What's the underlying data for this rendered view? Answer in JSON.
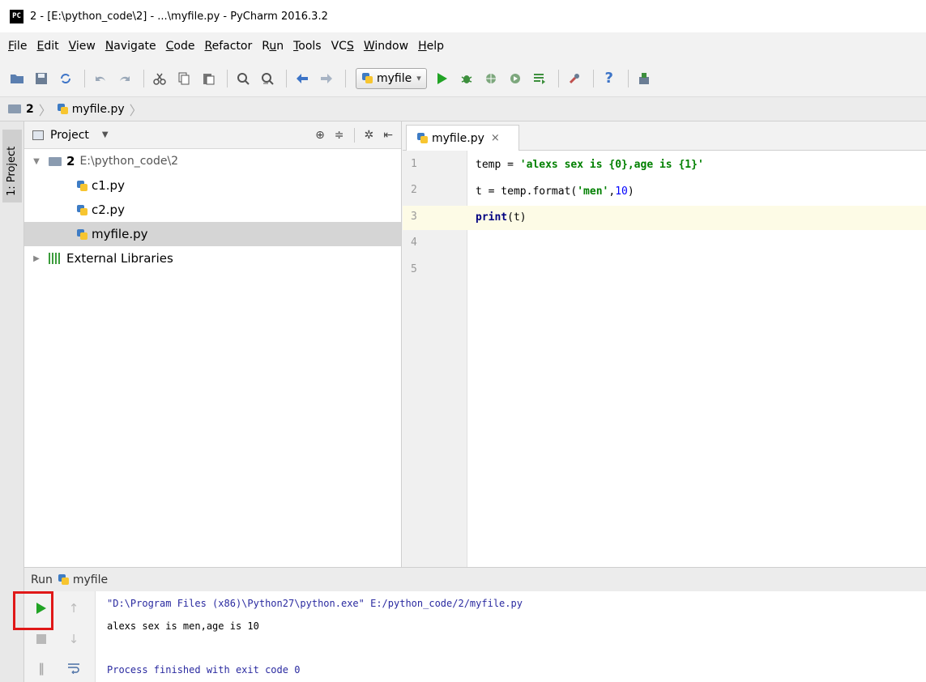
{
  "window": {
    "title": "2 - [E:\\python_code\\2] - ...\\myfile.py - PyCharm 2016.3.2",
    "logo_text": "PC"
  },
  "menu": {
    "items": [
      {
        "pre": "",
        "mnemonic": "F",
        "post": "ile"
      },
      {
        "pre": "",
        "mnemonic": "E",
        "post": "dit"
      },
      {
        "pre": "",
        "mnemonic": "V",
        "post": "iew"
      },
      {
        "pre": "",
        "mnemonic": "N",
        "post": "avigate"
      },
      {
        "pre": "",
        "mnemonic": "C",
        "post": "ode"
      },
      {
        "pre": "",
        "mnemonic": "R",
        "post": "efactor"
      },
      {
        "pre": "R",
        "mnemonic": "u",
        "post": "n"
      },
      {
        "pre": "",
        "mnemonic": "T",
        "post": "ools"
      },
      {
        "pre": "VC",
        "mnemonic": "S",
        "post": ""
      },
      {
        "pre": "",
        "mnemonic": "W",
        "post": "indow"
      },
      {
        "pre": "",
        "mnemonic": "H",
        "post": "elp"
      }
    ]
  },
  "toolbar": {
    "run_config": "myfile",
    "run_config_caret": "▾"
  },
  "breadcrumb": {
    "project": "2",
    "file": "myfile.py"
  },
  "side_tab": {
    "label": "1: Project"
  },
  "project_panel": {
    "title": "Project",
    "caret": "▼",
    "root": {
      "name": "2",
      "path": "E:\\python_code\\2"
    },
    "files": [
      {
        "name": "c1.py",
        "selected": false
      },
      {
        "name": "c2.py",
        "selected": false
      },
      {
        "name": "myfile.py",
        "selected": true
      }
    ],
    "external": "External Libraries"
  },
  "editor": {
    "tab": {
      "label": "myfile.py",
      "close": "×"
    },
    "line_numbers": [
      "1",
      "2",
      "3",
      "4",
      "5"
    ],
    "code": {
      "l1_a": "temp = ",
      "l1_str": "'alexs sex is {0},age is {1}'",
      "l2_a": "t = temp.format(",
      "l2_str": "'men'",
      "l2_b": ",",
      "l2_num": "10",
      "l2_c": ")",
      "l3_kw": "print",
      "l3_a": "(t)"
    }
  },
  "run": {
    "header_label": "Run",
    "config": "myfile",
    "console": {
      "cmd": "\"D:\\Program Files (x86)\\Python27\\python.exe\" E:/python_code/2/myfile.py",
      "output": "alexs sex is men,age is 10",
      "exit": "Process finished with exit code 0"
    }
  },
  "colors": {
    "run_green": "#21a325",
    "highlight_red": "#e01818"
  }
}
